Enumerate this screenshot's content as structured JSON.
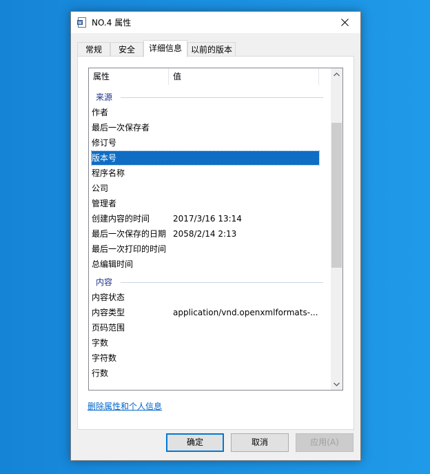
{
  "window": {
    "title": "NO.4 属性",
    "icon": "word-document-icon"
  },
  "tabs": [
    {
      "label": "常规"
    },
    {
      "label": "安全"
    },
    {
      "label": "详细信息",
      "active": true
    },
    {
      "label": "以前的版本"
    }
  ],
  "columns": {
    "property": "属性",
    "value": "值"
  },
  "groups": {
    "origin": "来源",
    "content": "内容"
  },
  "rows": {
    "author": {
      "name": "作者",
      "value": ""
    },
    "last_saved_by": {
      "name": "最后一次保存者",
      "value": ""
    },
    "revision": {
      "name": "修订号",
      "value": ""
    },
    "version": {
      "name": "版本号",
      "value": ""
    },
    "program": {
      "name": "程序名称",
      "value": ""
    },
    "company": {
      "name": "公司",
      "value": ""
    },
    "manager": {
      "name": "管理者",
      "value": ""
    },
    "content_created": {
      "name": "创建内容的时间",
      "value": "2017/3/16 13:14"
    },
    "date_last_saved": {
      "name": "最后一次保存的日期",
      "value": "2058/2/14 2:13"
    },
    "last_printed": {
      "name": "最后一次打印的时间",
      "value": ""
    },
    "total_editing_time": {
      "name": "总编辑时间",
      "value": ""
    },
    "content_status": {
      "name": "内容状态",
      "value": ""
    },
    "content_type": {
      "name": "内容类型",
      "value": "application/vnd.openxmlformats-..."
    },
    "page_range": {
      "name": "页码范围",
      "value": ""
    },
    "word_count": {
      "name": "字数",
      "value": ""
    },
    "char_count": {
      "name": "字符数",
      "value": ""
    },
    "line_count": {
      "name": "行数",
      "value": ""
    }
  },
  "selected_row": "版本号",
  "link": "删除属性和个人信息",
  "buttons": {
    "ok": "确定",
    "cancel": "取消",
    "apply": "应用(A)"
  },
  "colors": {
    "selection": "#0f6dc4",
    "link": "#0066cc",
    "desktop": "#1a8ee0"
  }
}
